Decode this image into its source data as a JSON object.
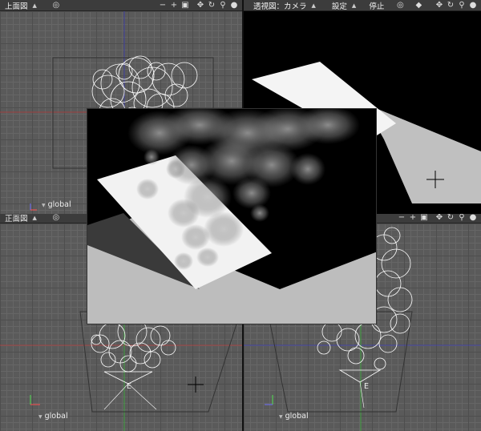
{
  "viewports": {
    "top": {
      "label": "上面図",
      "axis": "global"
    },
    "perspective": {
      "label": "透視図：カメラ",
      "settings": "設定",
      "stop": "停止"
    },
    "front": {
      "label": "正面図",
      "axis": "global"
    },
    "right": {
      "axis": "global"
    }
  },
  "markers": {
    "front_e": "E",
    "right_e": "E"
  },
  "icons": {
    "caret": "▲",
    "minus": "−",
    "plus": "+",
    "camera": "camera-icon",
    "move": "move-icon",
    "rotate": "rotate-icon",
    "zoom": "zoom-icon",
    "sphere": "sphere-icon",
    "target": "target-icon",
    "cube": "cube-icon"
  },
  "colors": {
    "grid_bg": "#5a5a5a",
    "toolbar": "#3c3c3c",
    "render_bg": "#000000"
  }
}
